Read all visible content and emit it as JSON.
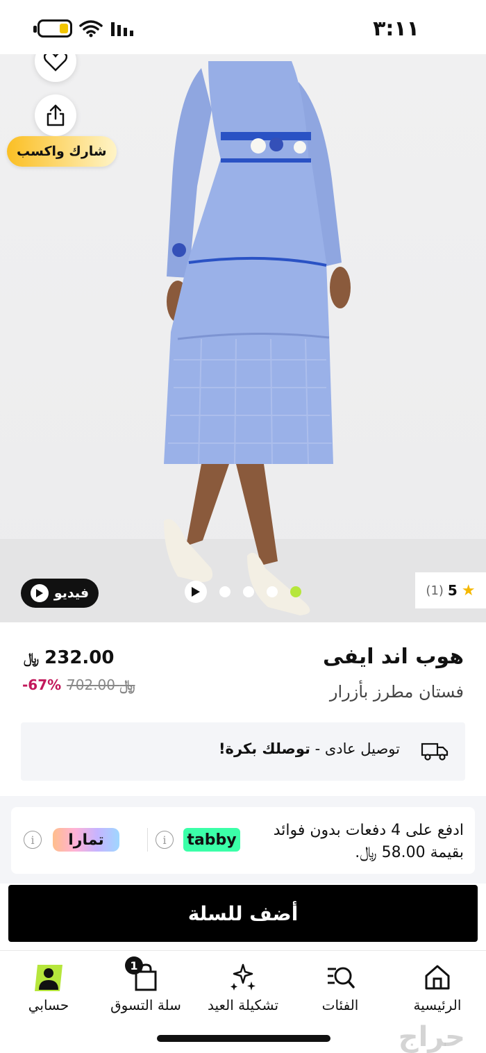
{
  "status_bar": {
    "time": "٣:١١"
  },
  "hero": {
    "share_earn_label": "شارك واكسب",
    "video_label": "فيديو",
    "rating_value": "5",
    "rating_count": "(1)",
    "slide_count": 4,
    "active_slide": 4
  },
  "product": {
    "brand": "هوب اند ايفى",
    "name": "فستان مطرز بأزرار",
    "price": "232.00",
    "old_price": "702.00",
    "currency_symbol": "﷼",
    "discount": "-67%"
  },
  "delivery": {
    "standard": "توصيل عادى -",
    "highlight": "توصلك بكرة!"
  },
  "installments": {
    "text": "ادفع على 4 دفعات بدون فوائد بقيمة 58.00 ﷼.",
    "tabby_label": "tabby",
    "tamara_label": "تمارا"
  },
  "cta": {
    "add_to_cart": "أضف للسلة"
  },
  "nav": {
    "home": "الرئيسية",
    "categories": "الفئات",
    "eid": "تشكيلة العيد",
    "cart": "سلة التسوق",
    "cart_count": "1",
    "account": "حسابي"
  },
  "colors": {
    "accent_yellow": "#fbbf24",
    "tabby_green": "#3bffa8",
    "discount_red": "#c2185b",
    "active_dot": "#b6e63c"
  },
  "watermark": "حراج"
}
